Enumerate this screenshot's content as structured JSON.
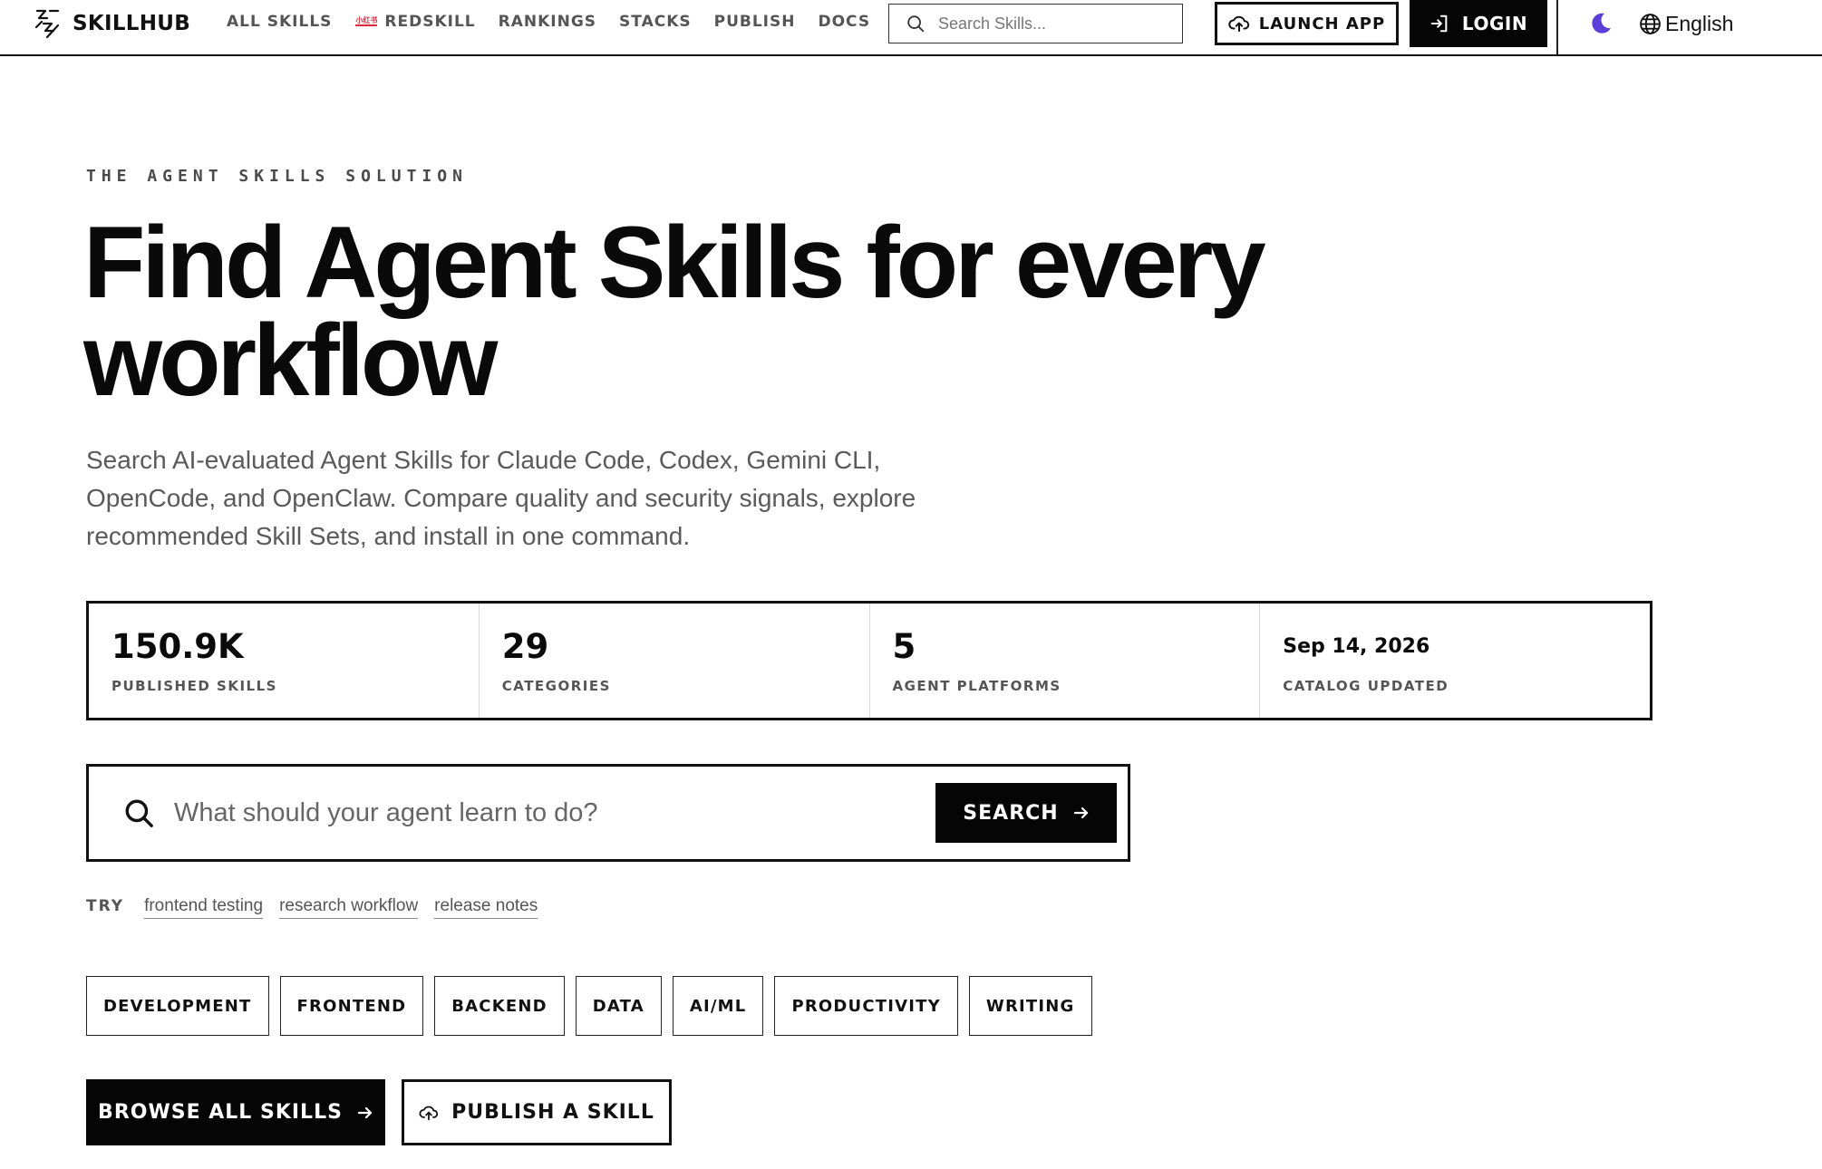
{
  "brand": {
    "name": "SKILLHUB",
    "logo_icon": "skillhub-logo-icon"
  },
  "nav": {
    "links": [
      {
        "label": "ALL SKILLS"
      },
      {
        "label": "REDSKILL",
        "badge": "小红书"
      },
      {
        "label": "RANKINGS"
      },
      {
        "label": "STACKS"
      },
      {
        "label": "PUBLISH"
      },
      {
        "label": "DOCS"
      }
    ],
    "search_placeholder": "Search Skills...",
    "launch_label": "LAUNCH APP",
    "login_label": "LOGIN",
    "language": "English"
  },
  "hero": {
    "eyebrow": "THE AGENT SKILLS SOLUTION",
    "headline_line1": "Find Agent Skills for every",
    "headline_line2": "workflow",
    "lede": "Search AI-evaluated Agent Skills for Claude Code, Codex, Gemini CLI, OpenCode, and OpenClaw. Compare quality and security signals, explore recommended Skill Sets, and install in one command."
  },
  "stats": [
    {
      "value": "150.9K",
      "label": "PUBLISHED SKILLS"
    },
    {
      "value": "29",
      "label": "CATEGORIES"
    },
    {
      "value": "5",
      "label": "AGENT PLATFORMS"
    },
    {
      "value": "Sep 14, 2026",
      "label": "CATALOG UPDATED"
    }
  ],
  "search": {
    "placeholder": "What should your agent learn to do?",
    "button_label": "SEARCH"
  },
  "try": {
    "label": "TRY",
    "suggestions": [
      "frontend testing",
      "research workflow",
      "release notes"
    ]
  },
  "categories": [
    "DEVELOPMENT",
    "FRONTEND",
    "BACKEND",
    "DATA",
    "AI/ML",
    "PRODUCTIVITY",
    "WRITING"
  ],
  "cta": {
    "browse_label": "BROWSE ALL SKILLS",
    "publish_label": "PUBLISH A SKILL"
  },
  "colors": {
    "ink": "#0a0a0a",
    "muted": "#5a5a5a",
    "accent_moon": "#5b3fd9",
    "badge_red": "#e2283d"
  }
}
